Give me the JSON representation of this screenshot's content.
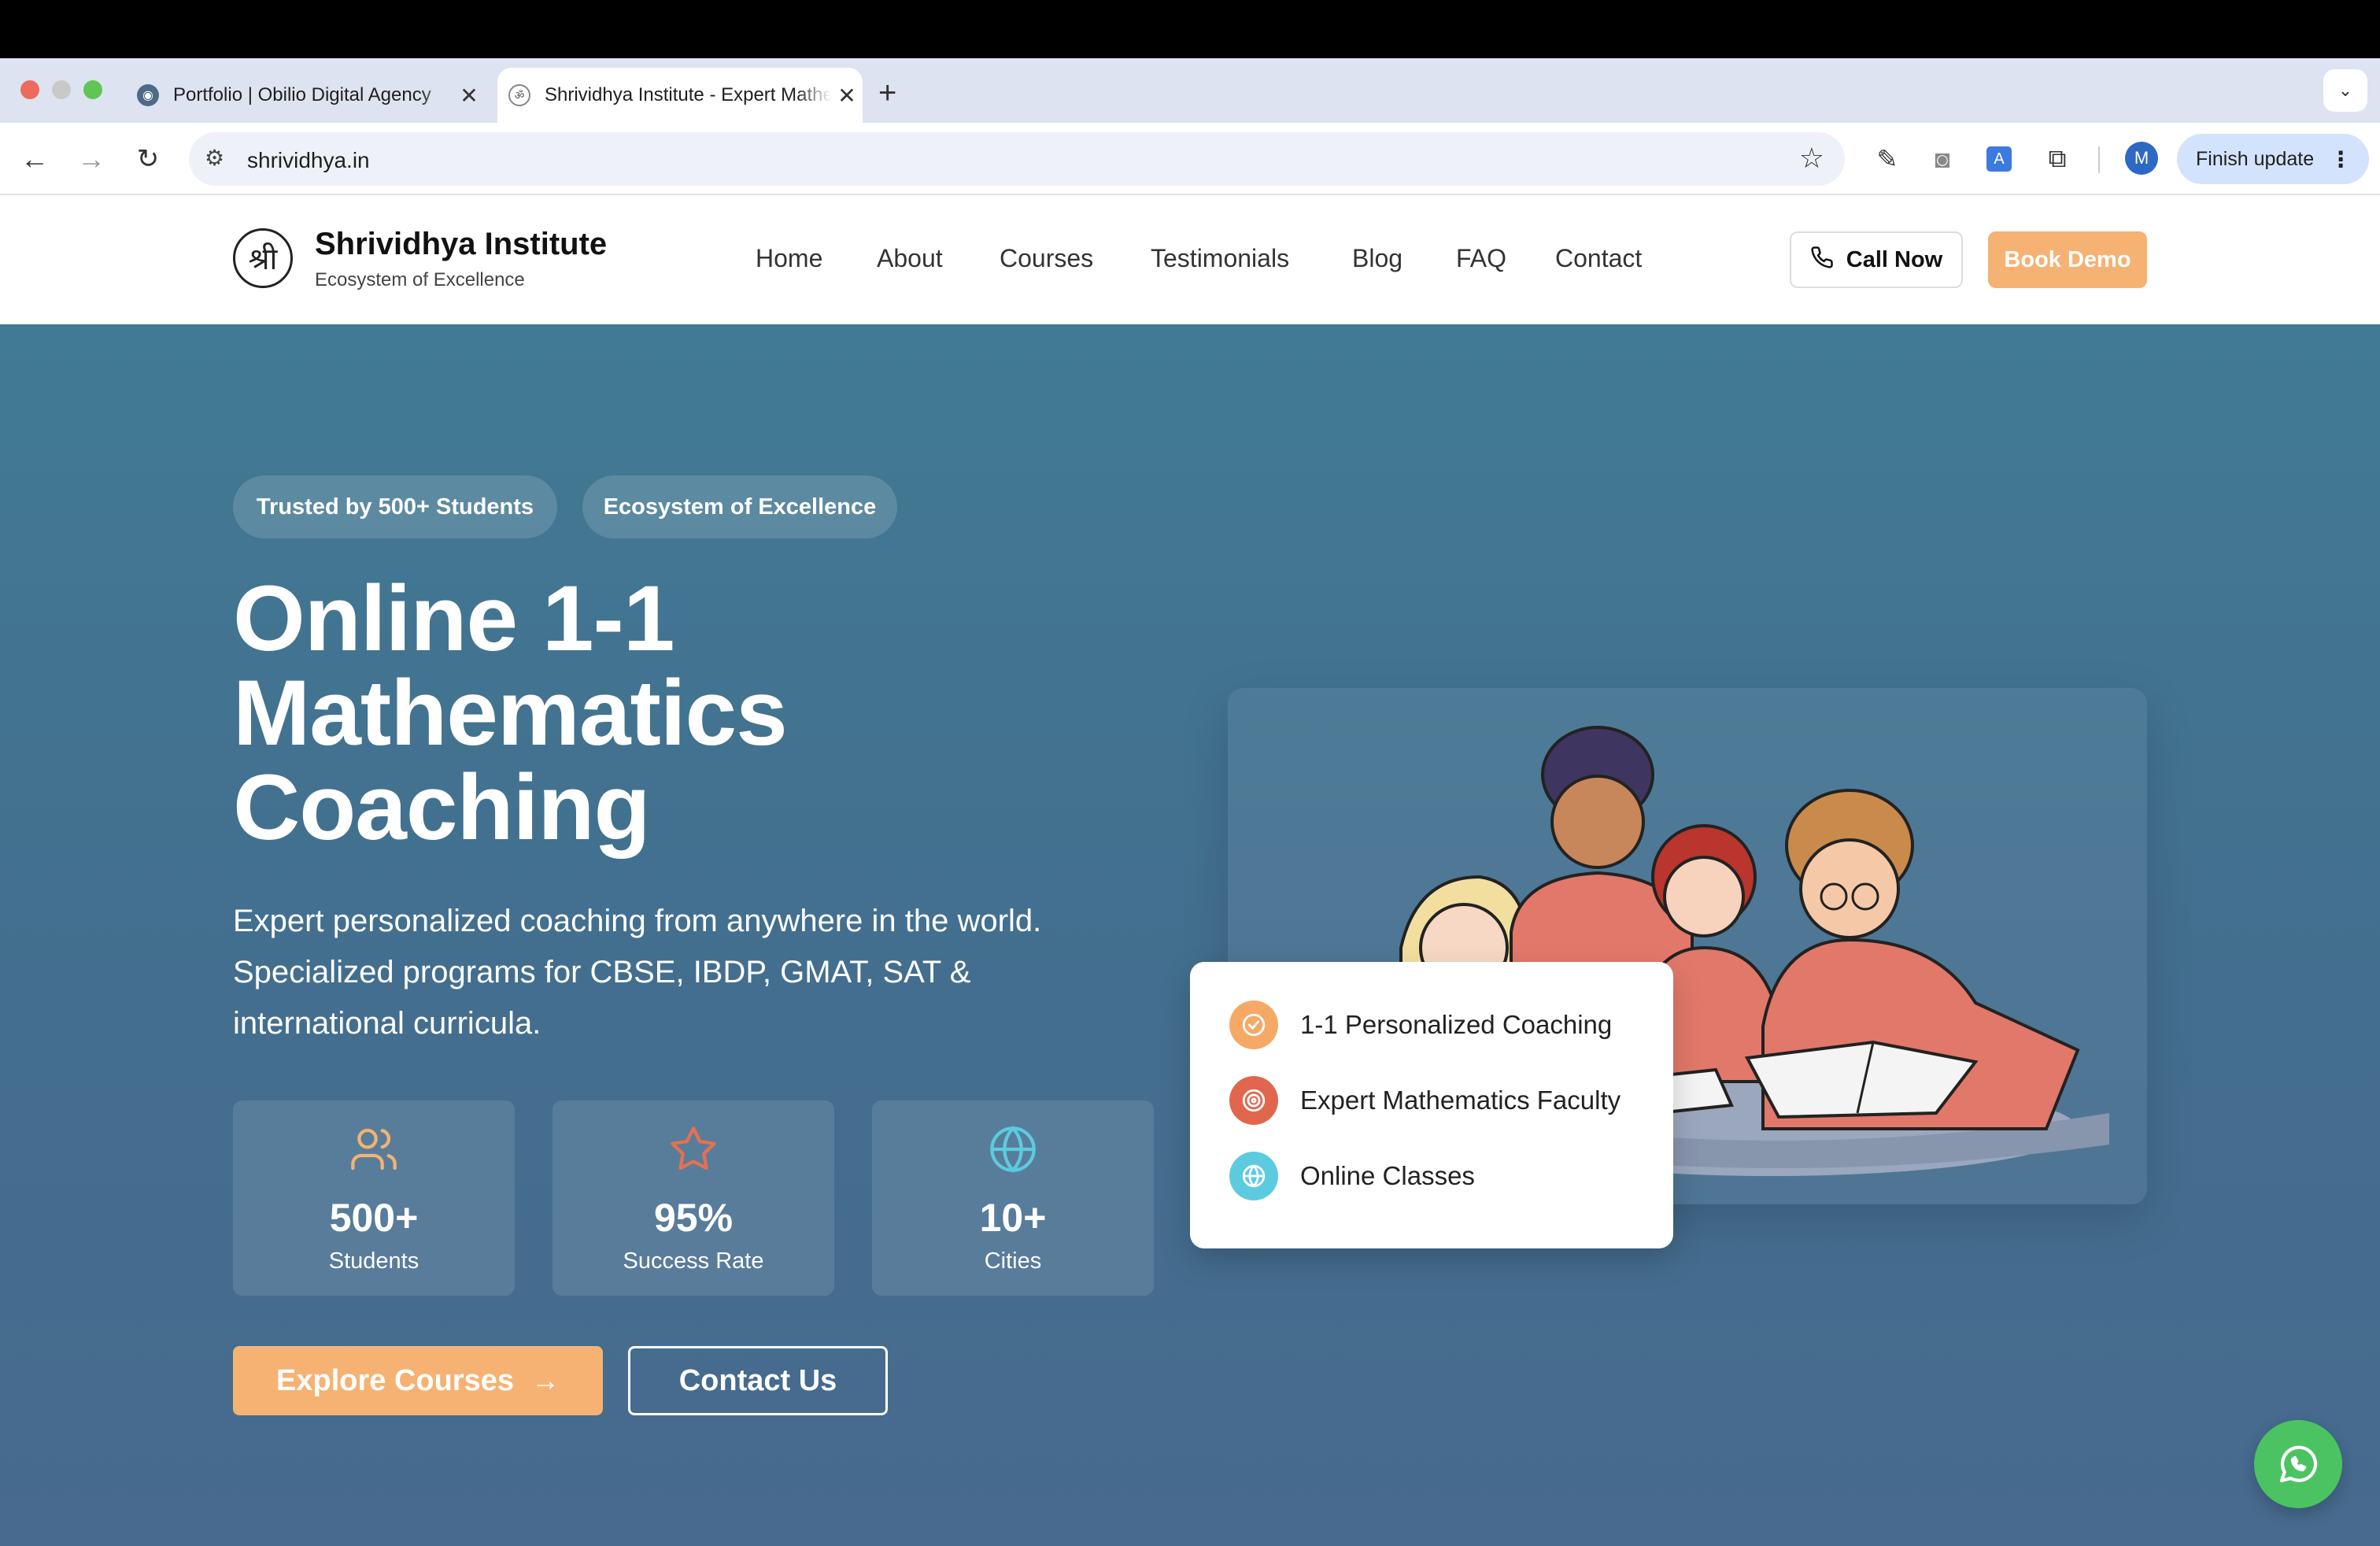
{
  "browser": {
    "tabs": [
      {
        "title": "Portfolio | Obilio Digital Agency",
        "close": "✕"
      },
      {
        "title": "Shrividhya Institute - Expert Mathematics",
        "close": "✕"
      }
    ],
    "new_tab": "+",
    "tab_menu": "⌄",
    "url": "shrividhya.in",
    "finish_update": "Finish update",
    "avatar_initial": "M"
  },
  "header": {
    "logo_glyph": "श्री",
    "brand_name": "Shrividhya Institute",
    "tagline": "Ecosystem of Excellence",
    "nav": [
      "Home",
      "About",
      "Courses",
      "Testimonials",
      "Blog",
      "FAQ",
      "Contact"
    ],
    "call_now": "Call Now",
    "book_demo": "Book Demo"
  },
  "hero": {
    "badges": [
      "Trusted by 500+ Students",
      "Ecosystem of Excellence"
    ],
    "title_lines": [
      "Online 1-1",
      "Mathematics",
      "Coaching"
    ],
    "description_lines": [
      "Expert personalized coaching from anywhere in the world.",
      "Specialized programs for CBSE, IBDP, GMAT, SAT &",
      "international curricula."
    ],
    "stats": [
      {
        "value": "500+",
        "label": "Students",
        "icon": "users-icon"
      },
      {
        "value": "95%",
        "label": "Success Rate",
        "icon": "star-icon"
      },
      {
        "value": "10+",
        "label": "Cities",
        "icon": "globe-icon"
      }
    ],
    "explore_button": "Explore Courses",
    "contact_button": "Contact Us",
    "features": [
      {
        "label": "1-1 Personalized Coaching",
        "icon": "check-circle-icon"
      },
      {
        "label": "Expert Mathematics Faculty",
        "icon": "target-icon"
      },
      {
        "label": "Online Classes",
        "icon": "globe-icon"
      }
    ]
  },
  "colors": {
    "accent_orange": "#f5b273",
    "hero_bg": "#417a93",
    "whatsapp_green": "#4cc362",
    "feature_orange": "#f5a964",
    "feature_red": "#e0674e",
    "feature_cyan": "#5ccbe0"
  }
}
